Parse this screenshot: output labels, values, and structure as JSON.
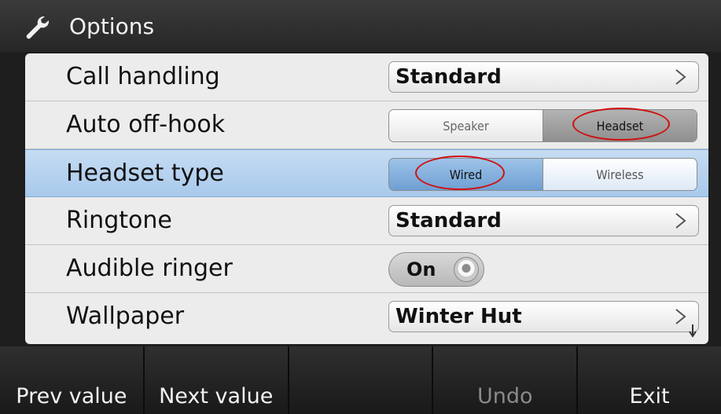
{
  "header": {
    "title": "Options",
    "icon": "wrench-icon"
  },
  "rows": [
    {
      "label": "Call handling",
      "value": "Standard"
    },
    {
      "label": "Auto off-hook",
      "options": [
        "Speaker",
        "Headset"
      ],
      "selected": "Headset"
    },
    {
      "label": "Headset type",
      "options": [
        "Wired",
        "Wireless"
      ],
      "selected": "Wired"
    },
    {
      "label": "Ringtone",
      "value": "Standard"
    },
    {
      "label": "Audible ringer",
      "toggle": "On"
    },
    {
      "label": "Wallpaper",
      "value": "Winter Hut"
    }
  ],
  "softkeys": [
    "Prev value",
    "Next value",
    "",
    "Undo",
    "Exit"
  ],
  "colors": {
    "selected_row": "#a8c9ec",
    "annotation_ring": "#d01010",
    "title_bar": "#2e2e2e"
  }
}
